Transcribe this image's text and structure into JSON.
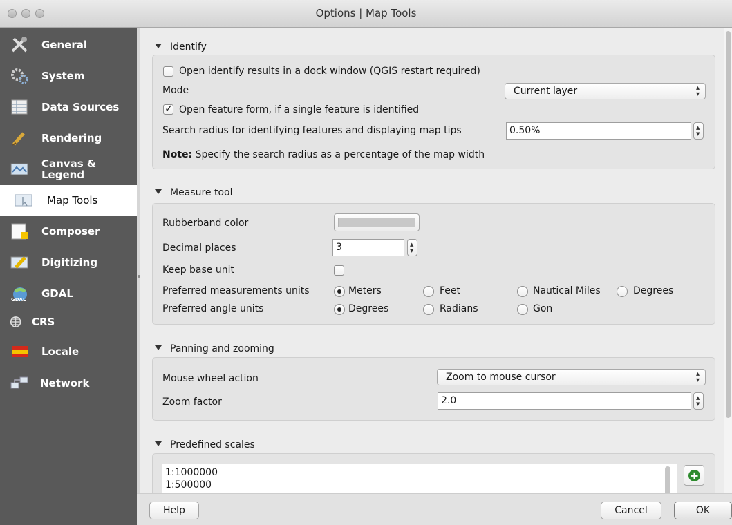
{
  "window": {
    "title": "Options | Map Tools"
  },
  "sidebar": {
    "items": [
      {
        "label": "General",
        "icon": "general-tools-icon"
      },
      {
        "label": "System",
        "icon": "system-gear-icon"
      },
      {
        "label": "Data Sources",
        "icon": "table-icon"
      },
      {
        "label": "Rendering",
        "icon": "paintbrush-icon"
      },
      {
        "label": "Canvas &",
        "label2": "Legend",
        "icon": "canvas-map-icon"
      },
      {
        "label": "Map Tools",
        "icon": "map-tools-icon"
      },
      {
        "label": "Composer",
        "icon": "composer-icon"
      },
      {
        "label": "Digitizing",
        "icon": "digitizing-pencil-icon"
      },
      {
        "label": "GDAL",
        "icon": "gdal-icon"
      },
      {
        "label": "CRS",
        "icon": "globe-icon"
      },
      {
        "label": "Locale",
        "icon": "flag-icon"
      },
      {
        "label": "Network",
        "icon": "network-icon"
      }
    ],
    "active": "Map Tools"
  },
  "identify": {
    "heading": "Identify",
    "dock_label": "Open identify results in a dock window (QGIS restart required)",
    "dock_checked": false,
    "mode_label": "Mode",
    "mode_value": "Current layer",
    "feature_form_label": "Open feature form, if a single feature is identified",
    "feature_form_checked": true,
    "radius_label": "Search radius for identifying features and displaying map tips",
    "radius_value": "0.50%",
    "note_bold": "Note:",
    "note_text": "Specify the search radius as a percentage of the map width"
  },
  "measure": {
    "heading": "Measure tool",
    "rubberband_label": "Rubberband color",
    "rubberband_color": "#c8c8c8",
    "decimal_label": "Decimal places",
    "decimal_value": "3",
    "keep_base_label": "Keep base unit",
    "keep_base_checked": false,
    "units_label": "Preferred measurements units",
    "units_options": [
      "Meters",
      "Feet",
      "Nautical Miles",
      "Degrees"
    ],
    "units_selected": "Meters",
    "angle_label": "Preferred angle units",
    "angle_options": [
      "Degrees",
      "Radians",
      "Gon"
    ],
    "angle_selected": "Degrees"
  },
  "panning": {
    "heading": "Panning and zooming",
    "wheel_label": "Mouse wheel action",
    "wheel_value": "Zoom to mouse cursor",
    "zoom_label": "Zoom factor",
    "zoom_value": "2.0"
  },
  "scales": {
    "heading": "Predefined scales",
    "items": [
      "1:1000000",
      "1:500000"
    ]
  },
  "buttons": {
    "help": "Help",
    "cancel": "Cancel",
    "ok": "OK"
  }
}
